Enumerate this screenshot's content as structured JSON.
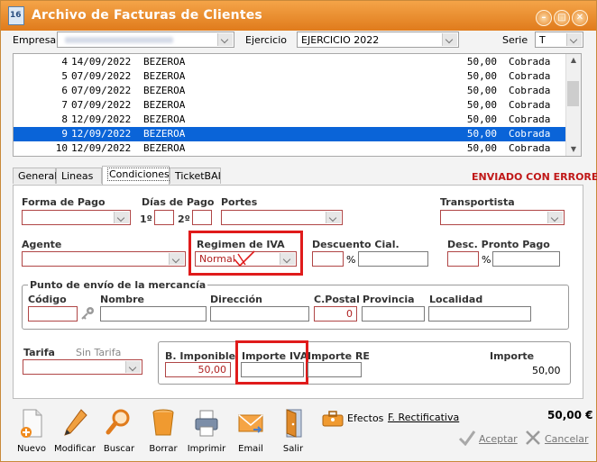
{
  "window": {
    "title": "Archivo de Facturas de Clientes",
    "app_icon": "16"
  },
  "header": {
    "empresa_label": "Empresa",
    "ejercicio_label": "Ejercicio",
    "ejercicio_value": "EJERCICIO 2022",
    "serie_label": "Serie",
    "serie_value": "T"
  },
  "invoices": [
    {
      "num": "4",
      "date": "14/09/2022",
      "client": "BEZEROA",
      "amount": "50,00",
      "status": "Cobrada"
    },
    {
      "num": "5",
      "date": "07/09/2022",
      "client": "BEZEROA",
      "amount": "50,00",
      "status": "Cobrada"
    },
    {
      "num": "6",
      "date": "07/09/2022",
      "client": "BEZEROA",
      "amount": "50,00",
      "status": "Cobrada"
    },
    {
      "num": "7",
      "date": "07/09/2022",
      "client": "BEZEROA",
      "amount": "50,00",
      "status": "Cobrada"
    },
    {
      "num": "8",
      "date": "12/09/2022",
      "client": "BEZEROA",
      "amount": "50,00",
      "status": "Cobrada"
    },
    {
      "num": "9",
      "date": "12/09/2022",
      "client": "BEZEROA",
      "amount": "50,00",
      "status": "Cobrada"
    },
    {
      "num": "10",
      "date": "12/09/2022",
      "client": "BEZEROA",
      "amount": "50,00",
      "status": "Cobrada"
    }
  ],
  "selected_invoice_index": 5,
  "tabs": [
    {
      "label": "General",
      "key": "G"
    },
    {
      "label": "Lineas",
      "key": "L"
    },
    {
      "label": "Condiciones",
      "key": "C"
    },
    {
      "label": "TicketBAI",
      "key": ""
    }
  ],
  "active_tab": "Condiciones",
  "status_text": "ENVIADO CON ERRORES",
  "form": {
    "forma_pago_label": "Forma de Pago",
    "dias_pago_label": "Días de Pago",
    "dia1_label": "1º",
    "dia2_label": "2º",
    "portes_label": "Portes",
    "transportista_label": "Transportista",
    "agente_label": "Agente",
    "regimen_iva_label": "Regimen de IVA",
    "regimen_iva_value": "Normal",
    "descuento_cial_label": "Descuento Cial.",
    "desc_pronto_pago_label": "Desc. Pronto Pago",
    "percent_symbol": "%",
    "punto_envio_legend": "Punto de envío de la mercancía",
    "codigo_label": "Código",
    "nombre_label": "Nombre",
    "direccion_label": "Dirección",
    "cpostal_label": "C.Postal",
    "cpostal_value": "0",
    "provincia_label": "Provincia",
    "localidad_label": "Localidad",
    "tarifa_label": "Tarifa",
    "tarifa_value": "Sin Tarifa",
    "b_imponible_label": "B. Imponible",
    "b_imponible_value": "50,00",
    "importe_iva_label": "Importe IVA",
    "importe_re_label": "Importe RE",
    "importe_label": "Importe",
    "importe_value": "50,00"
  },
  "toolbar": {
    "nuevo": "Nuevo",
    "modificar": "Modificar",
    "buscar": "Buscar",
    "borrar": "Borrar",
    "imprimir": "Imprimir",
    "email": "Email",
    "salir": "Salir",
    "efectos": "Efectos",
    "f_rectificativa": "F. Rectificativa",
    "total": "50,00 €",
    "aceptar": "Aceptar",
    "cancelar": "Cancelar"
  },
  "colors": {
    "title_orange": "#e9892a",
    "selection_blue": "#0a64d8",
    "error_red": "#c01818",
    "highlight_red": "#e01b1b"
  },
  "icons": [
    "new-document-icon",
    "pencil-icon",
    "magnifier-icon",
    "trash-bin-icon",
    "printer-icon",
    "envelope-icon",
    "exit-door-icon",
    "toolbox-icon",
    "check-icon",
    "x-icon"
  ]
}
